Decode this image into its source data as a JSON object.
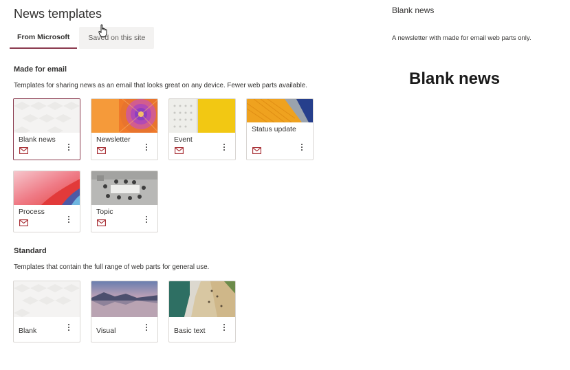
{
  "page": {
    "title": "News templates"
  },
  "tabs": [
    {
      "label": "From Microsoft",
      "active": true
    },
    {
      "label": "Saved on this site",
      "active": false
    }
  ],
  "sections": {
    "email": {
      "title": "Made for email",
      "description": "Templates for sharing news as an email that looks great on any device. Fewer web parts available."
    },
    "standard": {
      "title": "Standard",
      "description": "Templates that contain the full range of web parts for general use."
    }
  },
  "email_templates": [
    {
      "name": "Blank news",
      "icon": "mail-icon",
      "selected": true
    },
    {
      "name": "Newsletter",
      "icon": "mail-icon"
    },
    {
      "name": "Event",
      "icon": "mail-icon"
    },
    {
      "name": "Status update",
      "icon": "mail-icon"
    },
    {
      "name": "Process",
      "icon": "mail-icon"
    },
    {
      "name": "Topic",
      "icon": "mail-icon"
    }
  ],
  "standard_templates": [
    {
      "name": "Blank"
    },
    {
      "name": "Visual"
    },
    {
      "name": "Basic text"
    }
  ],
  "preview": {
    "header": "Blank news",
    "description": "A newsletter with made for email web parts only.",
    "heading": "Blank news"
  },
  "colors": {
    "accent": "#8a3a4e",
    "mail_icon": "#a4262c",
    "card_border": "#d9d6d3"
  }
}
